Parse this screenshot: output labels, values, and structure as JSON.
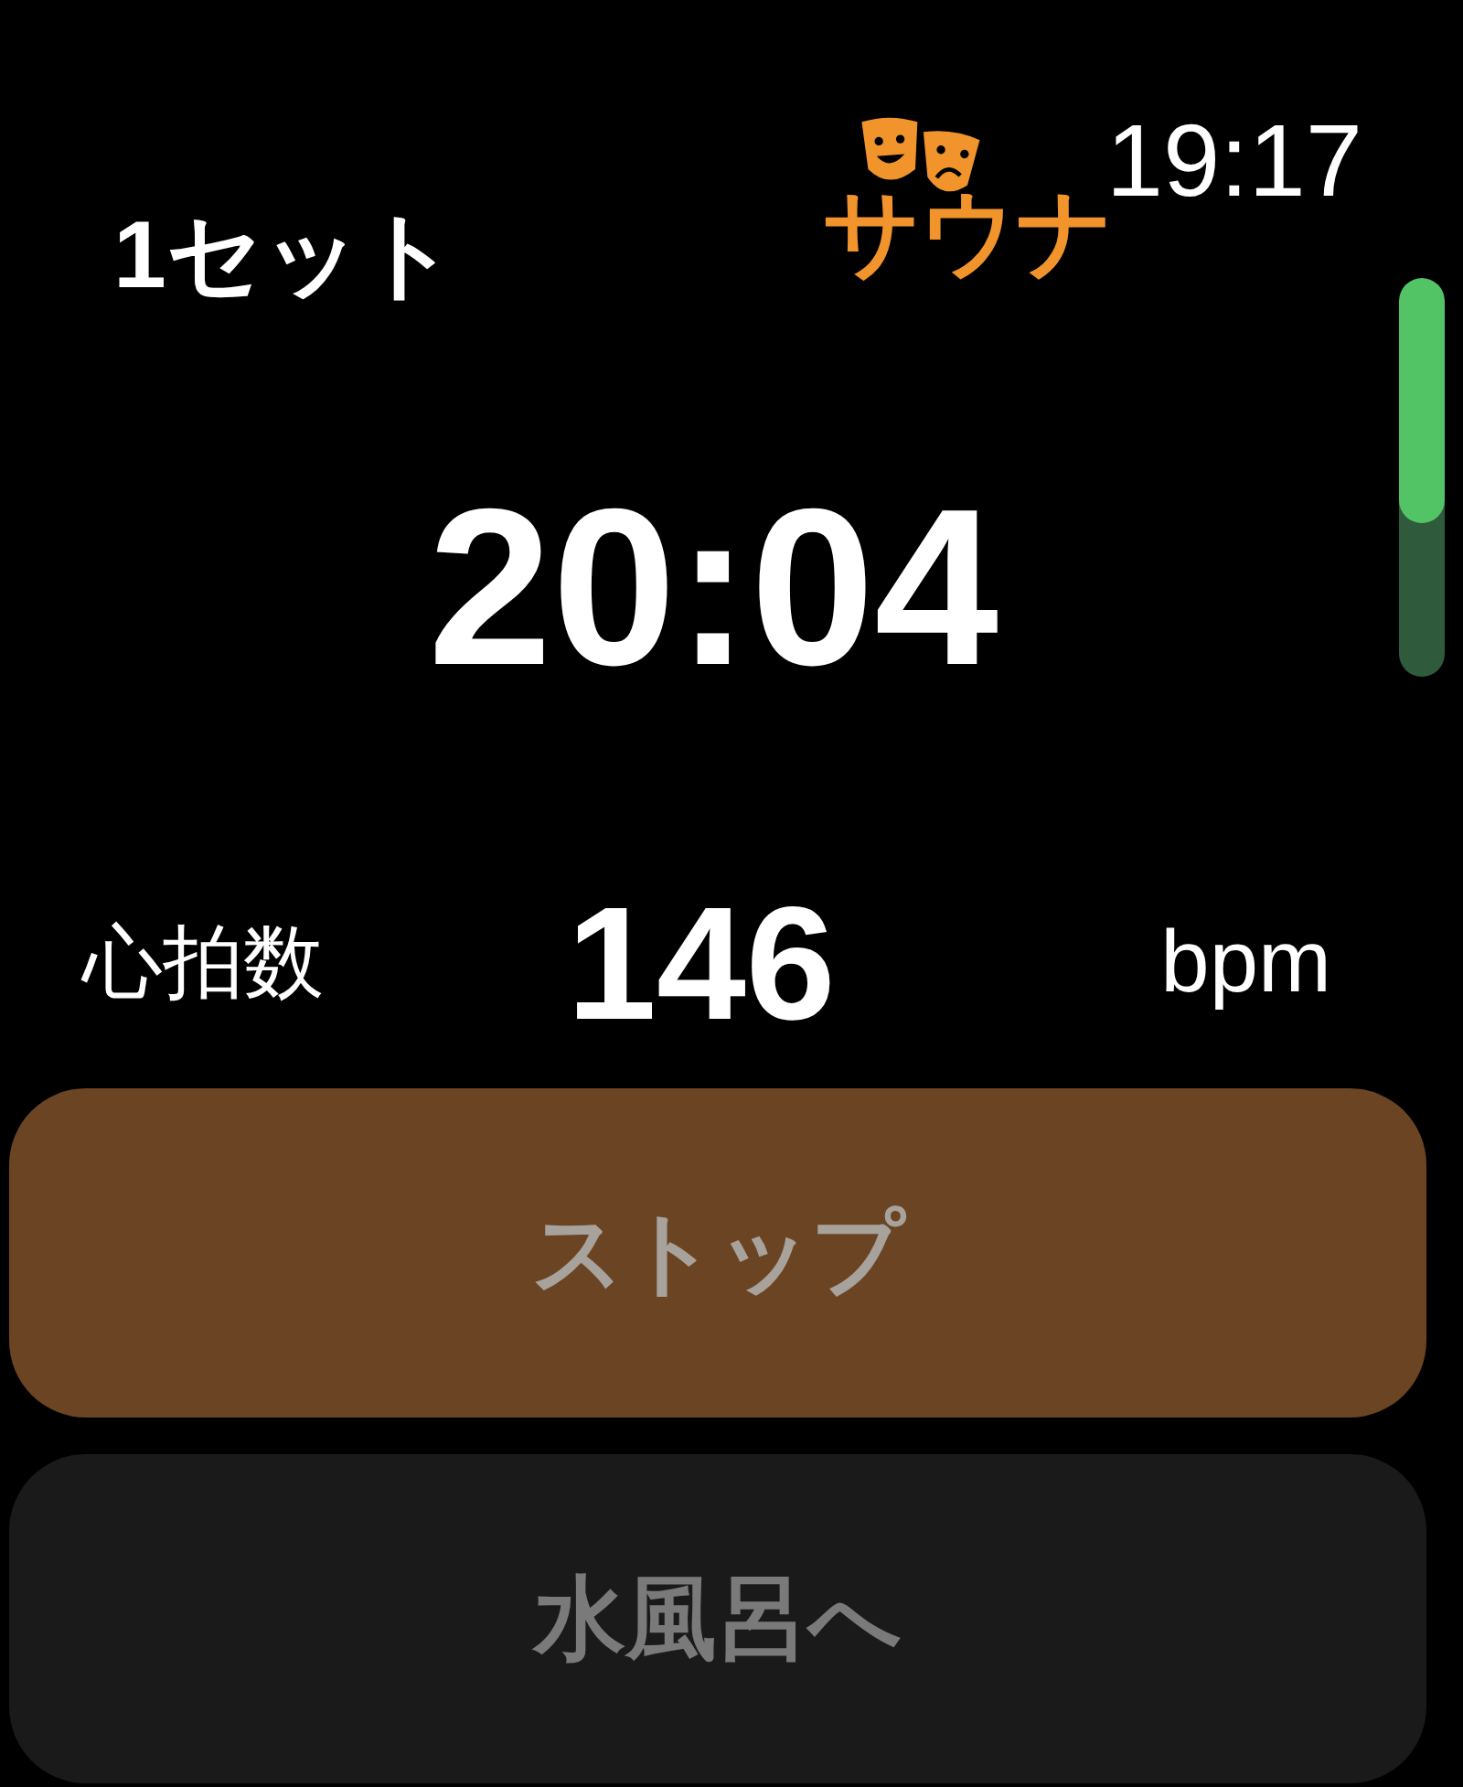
{
  "header": {
    "set_label": "1セット",
    "app_name": "サウナ",
    "time": "19:17"
  },
  "timer": "20:04",
  "heart_rate": {
    "label": "心拍数",
    "value": "146",
    "unit": "bpm"
  },
  "buttons": [
    {
      "label": "ストップ",
      "kind": "primary"
    },
    {
      "label": "水風呂へ",
      "kind": "secondary"
    }
  ]
}
